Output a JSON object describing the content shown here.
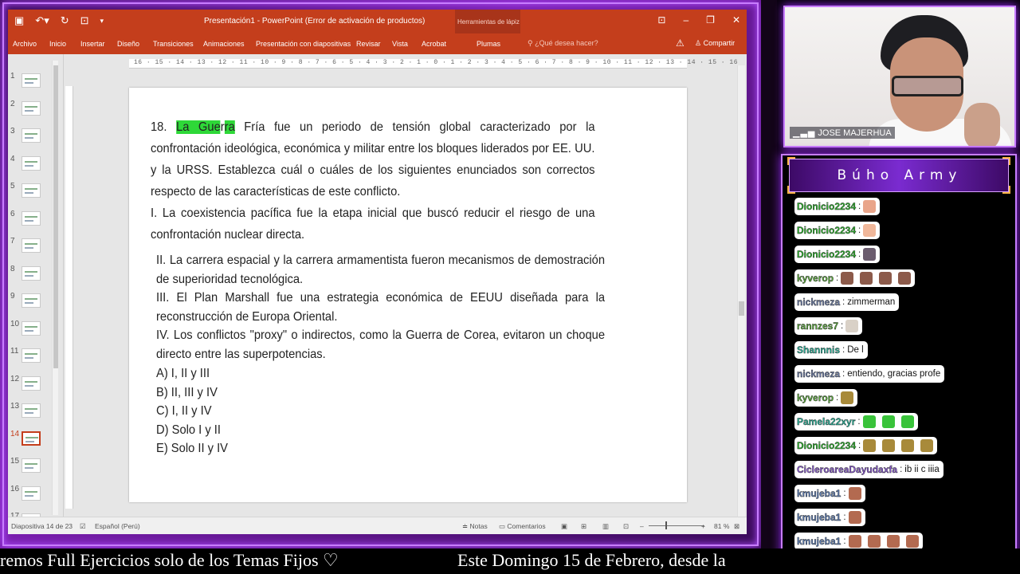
{
  "window": {
    "title": "Presentación1 - PowerPoint (Error de activación de productos)",
    "context_tab_title": "Herramientas de lápiz"
  },
  "ribbon": {
    "tabs": [
      "Archivo",
      "Inicio",
      "Insertar",
      "Diseño",
      "Transiciones",
      "Animaciones",
      "Presentación con diapositivas",
      "Revisar",
      "Vista",
      "Acrobat",
      "Plumas"
    ],
    "tell_me": "¿Qué desea hacer?",
    "share": "Compartir"
  },
  "ruler": "16 · 15 · 14 · 13 · 12 · 11 · 10 · 9 · 8 · 7 · 6 · 5 · 4 · 3 · 2 · 1 · 0 · 1 · 2 · 3 · 4 · 5 · 6 · 7 · 8 · 9 · 10 · 11 · 12 · 13 · 14 · 15 · 16",
  "thumbnails": [
    "1",
    "2",
    "3",
    "4",
    "5",
    "6",
    "7",
    "8",
    "9",
    "10",
    "11",
    "12",
    "13",
    "14",
    "15",
    "16",
    "17"
  ],
  "active_slide": 14,
  "slide": {
    "number": "18.",
    "hl_1": "La Gue",
    "gap": "r",
    "hl_2": "ra",
    "p1_rest": " Fría fue un periodo de tensión global caracterizado por la confrontación ideológica, económica y militar entre los bloques liderados por EE. UU. y la URSS. Establezca cuál o cuáles de los siguientes enunciados son correctos respecto de las características de este conflicto.",
    "p2": "I. La coexistencia pacífica fue la etapa inicial que buscó reducir el riesgo de una confrontación nuclear directa.",
    "p3": "II. La carrera espacial y la carrera armamentista fueron mecanismos de demostración de superioridad tecnológica.",
    "p4": "III. El Plan Marshall fue una estrategia económica de EEUU diseñada para la reconstrucción de Europa Oriental.",
    "p5": "IV. Los conflictos \"proxy\" o indirectos, como la Guerra de Corea, evitaron un choque directo entre las superpotencias.",
    "options": [
      "A) I, II y III",
      "B) II, III y IV",
      "C) I, II y IV",
      "D) Solo I y II",
      "E) Solo II y IV"
    ]
  },
  "status": {
    "slide_counter": "Diapositiva 14 de 23",
    "language": "Español (Perú)",
    "notes": "Notas",
    "comments": "Comentarios",
    "zoom": "81 %"
  },
  "webcam": {
    "name": "JOSE MAJERHUA"
  },
  "chat": {
    "title": "Búho Army",
    "messages": [
      {
        "user": "Dionicio2234",
        "color": "#2fb52f",
        "text": "",
        "emotes": [
          "#e9a58a"
        ]
      },
      {
        "user": "Dionicio2234",
        "color": "#2fb52f",
        "text": "",
        "emotes": [
          "#f0b79a"
        ]
      },
      {
        "user": "Dionicio2234",
        "color": "#2fb52f",
        "text": "",
        "emotes": [
          "#6b5c6e"
        ]
      },
      {
        "user": "kyverop",
        "color": "#5aa83c",
        "text": "",
        "emotes": [
          "#8c5a4a",
          "#8c5a4a",
          "#8c5a4a",
          "#8c5a4a"
        ]
      },
      {
        "user": "nickmeza",
        "color": "#6f7fa8",
        "text": "zimmerman",
        "emotes": []
      },
      {
        "user": "rannzes7",
        "color": "#5aa83c",
        "text": "",
        "emotes": [
          "#d9d1c7"
        ]
      },
      {
        "user": "Shannnis",
        "color": "#2bb39a",
        "text": "De l",
        "emotes": []
      },
      {
        "user": "nickmeza",
        "color": "#6f7fa8",
        "text": "entiendo, gracias profe",
        "emotes": []
      },
      {
        "user": "kyverop",
        "color": "#5aa83c",
        "text": "",
        "emotes": [
          "#a88a3a"
        ]
      },
      {
        "user": "Pamela22xyr",
        "color": "#2bb39a",
        "text": "",
        "emotes": [
          "#39c33a",
          "#39c33a",
          "#39c33a"
        ]
      },
      {
        "user": "Dionicio2234",
        "color": "#2fb52f",
        "text": "",
        "emotes": [
          "#a88a3a",
          "#a88a3a",
          "#a88a3a",
          "#a88a3a"
        ]
      },
      {
        "user": "CicleroareaDayudaxfa",
        "color": "#8a5ad0",
        "text": "ib ii c iiia",
        "emotes": []
      },
      {
        "user": "kmujeba1",
        "color": "#5f7fb5",
        "text": "",
        "emotes": [
          "#b36a50"
        ]
      },
      {
        "user": "kmujeba1",
        "color": "#5f7fb5",
        "text": "",
        "emotes": [
          "#b36a50"
        ]
      },
      {
        "user": "kmujeba1",
        "color": "#5f7fb5",
        "text": "",
        "emotes": [
          "#b36a50",
          "#b36a50",
          "#b36a50",
          "#b36a50"
        ]
      }
    ]
  },
  "ticker": {
    "left": "remos Full Ejercicios solo de los Temas Fijos ♡",
    "right": "Este Domingo 15 de Febrero, desde la"
  },
  "colors": {
    "ppt_accent": "#c43e1c",
    "stream_purple": "#b04dff",
    "highlight": "#2ed838"
  }
}
